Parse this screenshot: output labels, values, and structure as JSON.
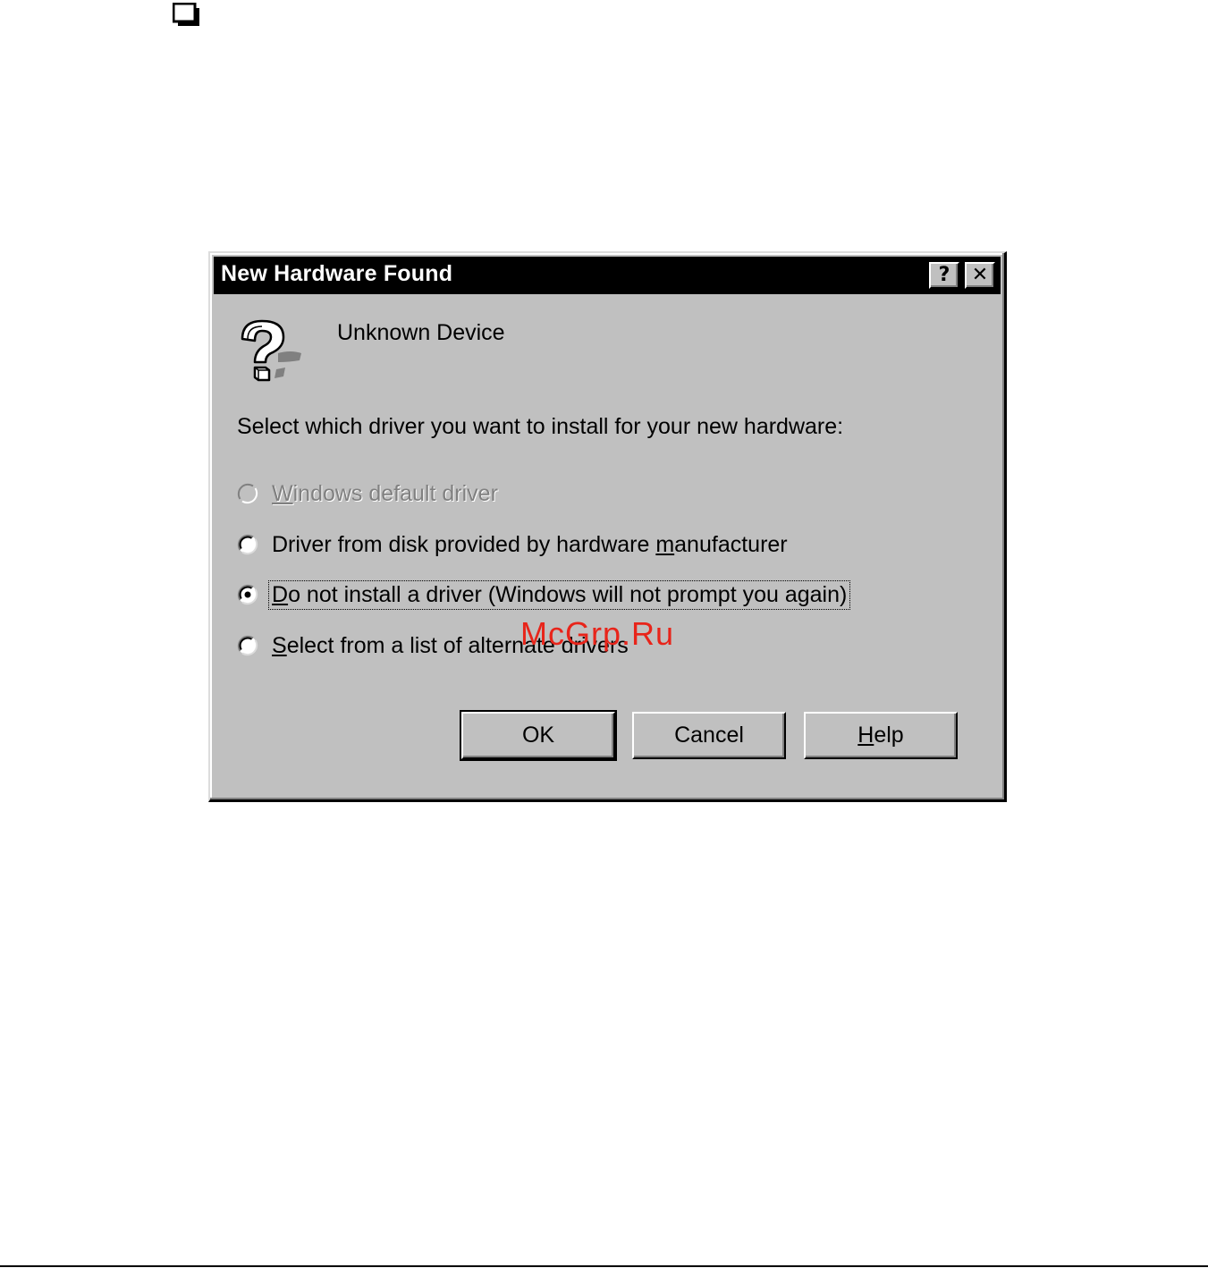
{
  "dialog": {
    "title": "New Hardware Found",
    "title_buttons": {
      "help_glyph": "?",
      "close_glyph": "✕"
    },
    "device_name": "Unknown Device",
    "device_icon": "question-mark-icon",
    "prompt": "Select which driver you want to install for your new hardware:",
    "options": [
      {
        "label": "Windows default driver",
        "mnemonic": "W",
        "rest": "indows default driver",
        "checked": false,
        "disabled": true
      },
      {
        "label": "Driver from disk provided by hardware manufacturer",
        "pre": "Driver from disk provided by hardware ",
        "mnemonic": "m",
        "rest": "anufacturer",
        "checked": false,
        "disabled": false
      },
      {
        "label": "Do not install a driver (Windows will not prompt you again)",
        "mnemonic": "D",
        "rest": "o not install a driver (Windows will not prompt you again)",
        "checked": true,
        "disabled": false,
        "focused": true
      },
      {
        "label": "Select from a list of alternate drivers",
        "mnemonic": "S",
        "rest": "elect from a list of alternate drivers",
        "checked": false,
        "disabled": false
      }
    ],
    "buttons": {
      "ok": "OK",
      "cancel": "Cancel",
      "help_mnemonic": "H",
      "help_rest": "elp"
    }
  },
  "watermark": "McGrp.Ru",
  "colors": {
    "dialog_face": "#c0c0c0",
    "titlebar": "#000000",
    "watermark": "#e8241a"
  }
}
